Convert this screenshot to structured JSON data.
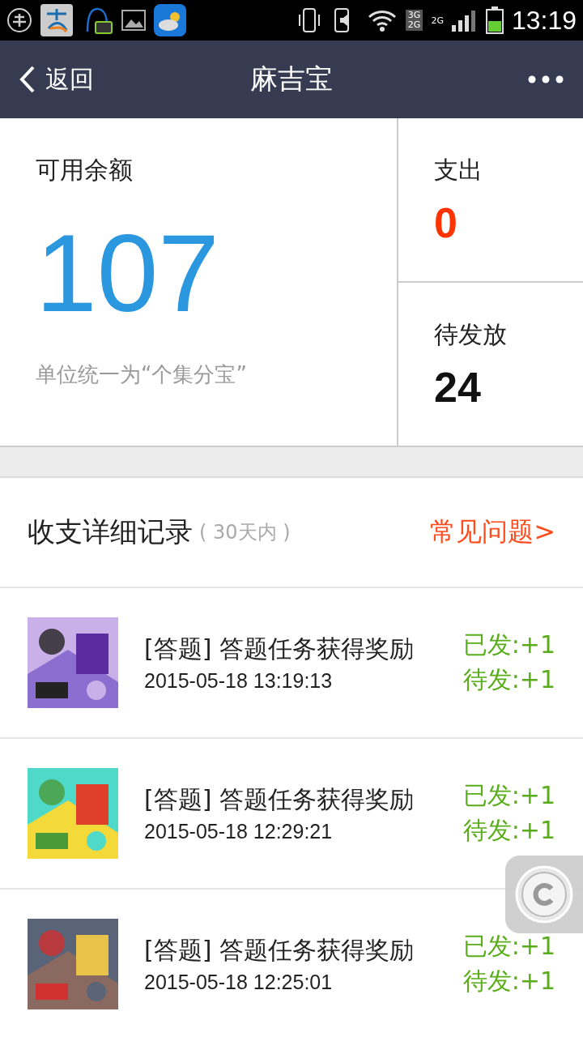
{
  "status_bar": {
    "network_labels": [
      "3G",
      "2G",
      "2G"
    ],
    "time": "13:19"
  },
  "nav_bar": {
    "back_label": "返回",
    "title": "麻吉宝"
  },
  "balance": {
    "label": "可用余额",
    "value": "107",
    "note": "单位统一为“个集分宝”"
  },
  "stats": [
    {
      "label": "支出",
      "value": "0",
      "color": "#ff3300"
    },
    {
      "label": "待发放",
      "value": "24",
      "color": "#111111"
    }
  ],
  "records_header": {
    "title": "收支详细记录",
    "range": "( 30天内 )",
    "faq_link": "常见问题>"
  },
  "records": [
    {
      "title": "[答题] 答题任务获得奖励",
      "time": "2015-05-18 13:19:13",
      "issued": "已发:+1",
      "pending": "待发:+1"
    },
    {
      "title": "[答题] 答题任务获得奖励",
      "time": "2015-05-18 12:29:21",
      "issued": "已发:+1",
      "pending": "待发:+1"
    },
    {
      "title": "[答题] 答题任务获得奖励",
      "time": "2015-05-18 12:25:01",
      "issued": "已发:+1",
      "pending": "待发:+1"
    }
  ]
}
